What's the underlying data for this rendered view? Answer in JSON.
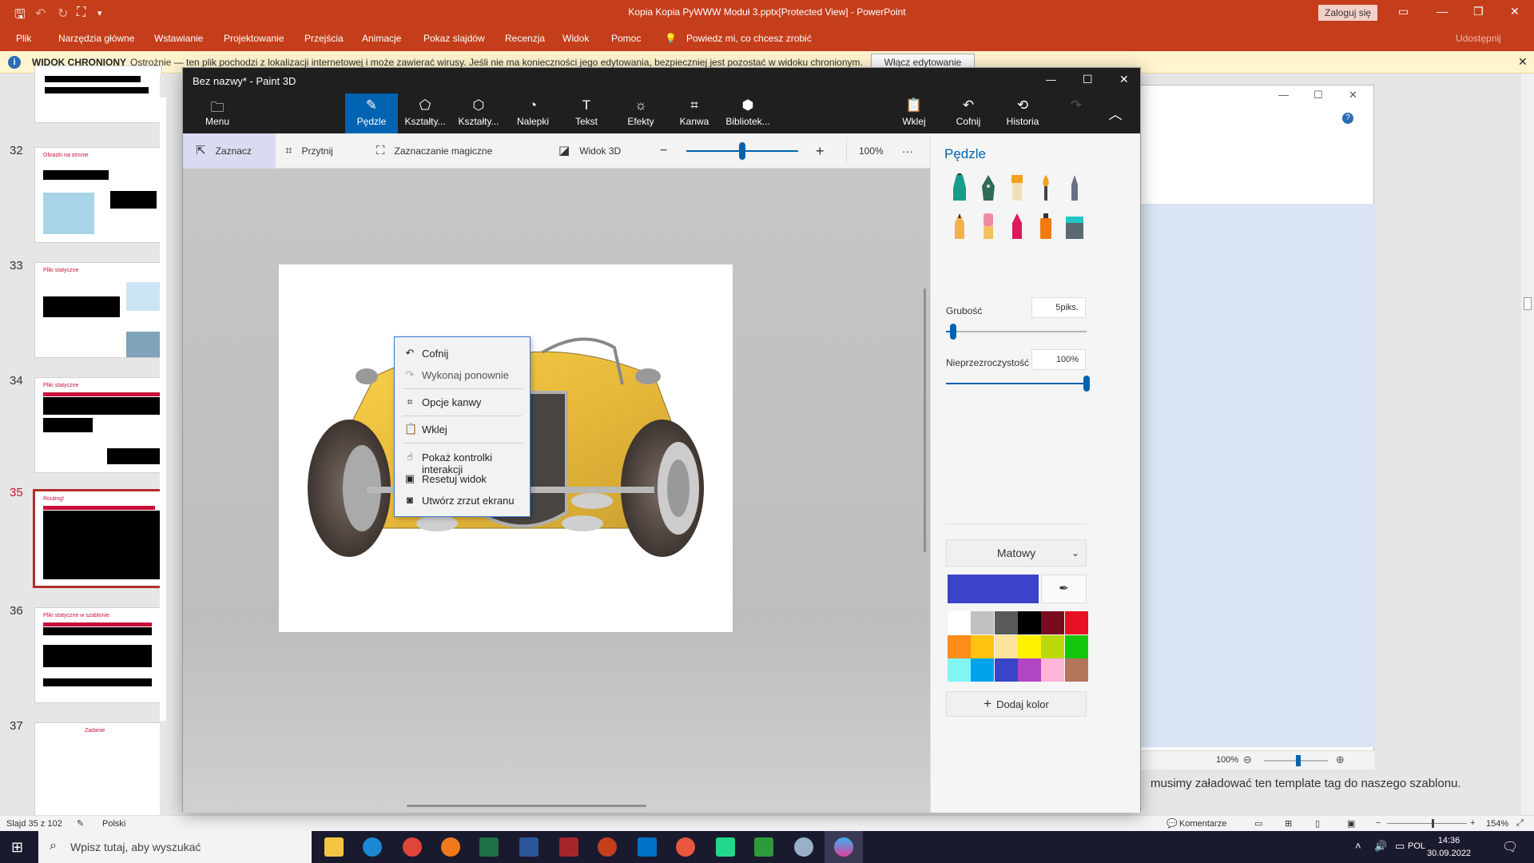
{
  "powerpoint": {
    "window_title": "Kopia Kopia PyWWW Moduł 3.pptx[Protected View] - PowerPoint",
    "signin_label": "Zaloguj się",
    "share_label": "Udostępnij",
    "ribbon_tabs": [
      "Plik",
      "Narzędzia główne",
      "Wstawianie",
      "Projektowanie",
      "Przejścia",
      "Animacje",
      "Pokaz slajdów",
      "Recenzja",
      "Widok",
      "Pomoc"
    ],
    "tell_me": "Powiedz mi, co chcesz zrobić",
    "protected_bar": {
      "title": "WIDOK CHRONIONY",
      "message": "Ostrożnie — ten plik pochodzi z lokalizacji internetowej i może zawierać wirusy. Jeśli nie ma konieczności jego edytowania, bezpieczniej jest pozostać w widoku chronionym.",
      "button": "Włącz edytowanie"
    },
    "slide_numbers": [
      "32",
      "33",
      "34",
      "35",
      "36",
      "37"
    ],
    "thumb_titles": [
      "Obrazki na stronie",
      "Pliki statyczne",
      "Pliki statyczne",
      "Routing!",
      "Pliki statyczne w szablonie",
      "Zadanie"
    ],
    "slide_text_visible": "musimy załadować ten template tag do naszego szablonu.",
    "status": {
      "slide_of": "Slajd 35 z 102",
      "language": "Polski",
      "comments": "Komentarze",
      "zoom": "154%"
    },
    "bg_window_zoom": "100%"
  },
  "paint3d": {
    "title": "Bez nazwy* - Paint 3D",
    "menu_label": "Menu",
    "tools": [
      {
        "label": "Pędzle",
        "icon": "brush-icon",
        "active": true
      },
      {
        "label": "Kształty...",
        "icon": "shapes2d-icon",
        "active": false
      },
      {
        "label": "Kształty...",
        "icon": "shapes3d-icon",
        "active": false
      },
      {
        "label": "Nalepki",
        "icon": "stickers-icon",
        "active": false
      },
      {
        "label": "Tekst",
        "icon": "text-icon",
        "active": false
      },
      {
        "label": "Efekty",
        "icon": "effects-icon",
        "active": false
      },
      {
        "label": "Kanwa",
        "icon": "canvas-icon",
        "active": false
      },
      {
        "label": "Bibliotek...",
        "icon": "library-icon",
        "active": false
      }
    ],
    "right_tools": [
      {
        "label": "Wklej",
        "icon": "paste-icon"
      },
      {
        "label": "Cofnij",
        "icon": "undo-icon"
      },
      {
        "label": "Historia",
        "icon": "history-icon"
      }
    ],
    "subbar": {
      "select": "Zaznacz",
      "crop": "Przytnij",
      "magic": "Zaznaczanie magiczne",
      "view3d": "Widok 3D",
      "zoom": "100%",
      "zoom_level": 0.5,
      "more": "···"
    },
    "context_menu": [
      {
        "label": "Cofnij",
        "icon": "undo-icon",
        "enabled": true
      },
      {
        "label": "Wykonaj ponownie",
        "icon": "redo-icon",
        "enabled": false
      },
      {
        "label": "Opcje kanwy",
        "icon": "canvas-icon",
        "enabled": true
      },
      {
        "label": "Wklej",
        "icon": "paste-icon",
        "enabled": true
      },
      {
        "label": "Pokaż kontrolki interakcji",
        "icon": "hand-icon",
        "enabled": true
      },
      {
        "label": "Resetuj widok",
        "icon": "reset-view-icon",
        "enabled": true
      },
      {
        "label": "Utwórz zrzut ekranu",
        "icon": "camera-icon",
        "enabled": true
      }
    ],
    "panel": {
      "title": "Pędzle",
      "thickness_label": "Grubość",
      "thickness_value": "5piks.",
      "thickness_level": 0.05,
      "opacity_label": "Nieprzezroczystość",
      "opacity_value": "100%",
      "opacity_level": 1.0,
      "finish": "Matowy",
      "add_color": "Dodaj kolor",
      "current_color": "#3b44c8",
      "palette": [
        "#ffffff",
        "#c0c0c0",
        "#5a5a5a",
        "#000000",
        "#7a0a1e",
        "#e81123",
        "#ff8c1a",
        "#ffc20e",
        "#fce59a",
        "#fff100",
        "#bad80a",
        "#16c60c",
        "#7ff5f5",
        "#00a2ed",
        "#3b44c8",
        "#b146c2",
        "#ffb3d9",
        "#b2745b"
      ],
      "brushes": [
        "marker",
        "calligraphy-pen",
        "oil-brush",
        "watercolor",
        "pixel-pen",
        "pencil",
        "eraser",
        "crayon",
        "spray-can",
        "fill"
      ]
    }
  },
  "taskbar": {
    "search_placeholder": "Wpisz tutaj, aby wyszukać",
    "language": "POL",
    "time": "14:36",
    "date": "30.09.2022"
  }
}
